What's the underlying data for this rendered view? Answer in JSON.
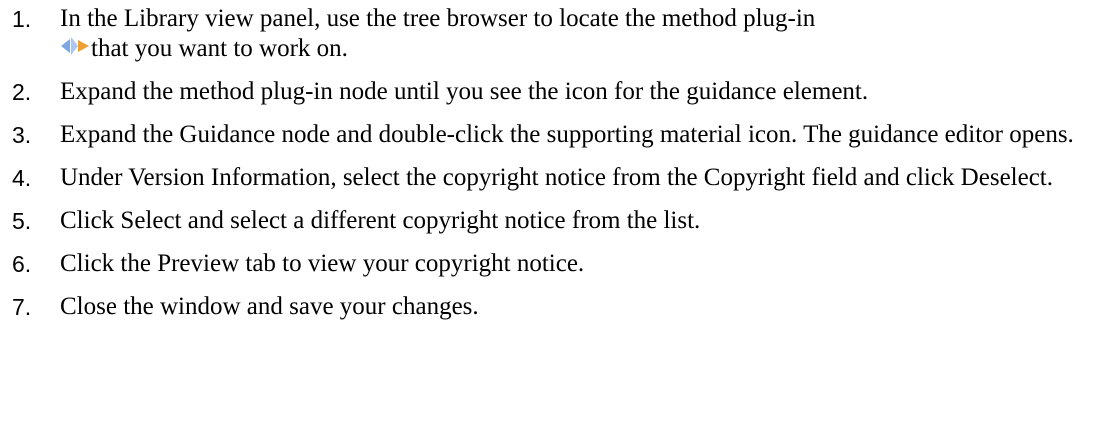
{
  "steps": [
    {
      "number": "1.",
      "text_before_icon": "In the Library view panel, use the tree browser to locate the method plug-in",
      "icon": "method-plugin-icon",
      "text_after_icon": "that you want to work on."
    },
    {
      "number": "2.",
      "text": "Expand the method plug-in node until you see the icon for the guidance element."
    },
    {
      "number": "3.",
      "text": "Expand the Guidance node and double-click the supporting material icon.  The guidance editor opens."
    },
    {
      "number": "4.",
      "text": "Under Version Information, select the copyright notice from the Copyright field and click Deselect."
    },
    {
      "number": "5.",
      "text": "Click Select and select a different copyright notice from the list."
    },
    {
      "number": "6.",
      "text": "Click the Preview tab to view your copyright notice."
    },
    {
      "number": "7.",
      "text": "Close the window and save your changes."
    }
  ],
  "colors": {
    "text": "#000000",
    "icon_blue": "#7ea6e0",
    "icon_orange": "#f0a030"
  }
}
